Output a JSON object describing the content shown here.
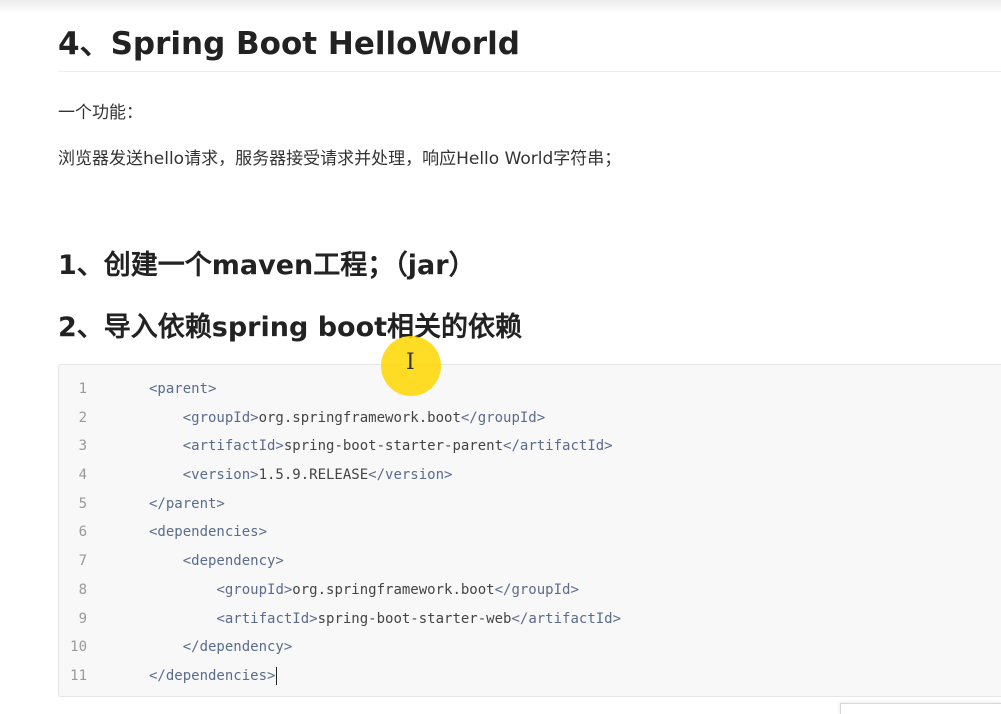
{
  "heading": "4、Spring Boot HelloWorld",
  "feature_label": "一个功能：",
  "feature_desc": "浏览器发送hello请求，服务器接受请求并处理，响应Hello World字符串；",
  "steps": [
    "1、创建一个maven工程；（jar）",
    "2、导入依赖spring boot相关的依赖"
  ],
  "code": {
    "line_numbers": [
      "1",
      "2",
      "3",
      "4",
      "5",
      "6",
      "7",
      "8",
      "9",
      "10",
      "11"
    ],
    "lines": [
      {
        "indent": "",
        "open": "<parent>",
        "text": "",
        "close": ""
      },
      {
        "indent": "    ",
        "open": "<groupId>",
        "text": "org.springframework.boot",
        "close": "</groupId>"
      },
      {
        "indent": "    ",
        "open": "<artifactId>",
        "text": "spring-boot-starter-parent",
        "close": "</artifactId>"
      },
      {
        "indent": "    ",
        "open": "<version>",
        "text": "1.5.9.RELEASE",
        "close": "</version>"
      },
      {
        "indent": "",
        "open": "</parent>",
        "text": "",
        "close": ""
      },
      {
        "indent": "",
        "open": "<dependencies>",
        "text": "",
        "close": ""
      },
      {
        "indent": "    ",
        "open": "<dependency>",
        "text": "",
        "close": ""
      },
      {
        "indent": "        ",
        "open": "<groupId>",
        "text": "org.springframework.boot",
        "close": "</groupId>"
      },
      {
        "indent": "        ",
        "open": "<artifactId>",
        "text": "spring-boot-starter-web",
        "close": "</artifactId>"
      },
      {
        "indent": "    ",
        "open": "</dependency>",
        "text": "",
        "close": ""
      },
      {
        "indent": "",
        "open": "</dependencies>",
        "text": "",
        "close": ""
      }
    ]
  },
  "cursor_icon": "text-ibeam-icon",
  "cursor_highlight_color": "#ffd700"
}
